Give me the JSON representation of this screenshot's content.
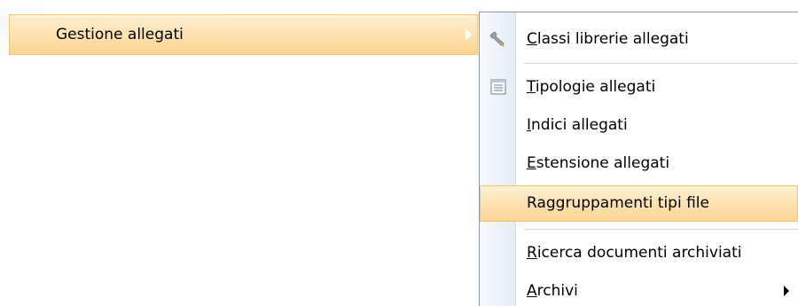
{
  "parent_menu": {
    "item_label": "Gestione allegati"
  },
  "submenu": {
    "items": [
      {
        "mnemonic": "C",
        "rest": "lassi librerie allegati",
        "icon": "wrench-icon"
      },
      {
        "mnemonic": "T",
        "rest": "ipologie allegati",
        "icon": "list-icon"
      },
      {
        "mnemonic": "I",
        "rest": "ndici allegati",
        "icon": ""
      },
      {
        "mnemonic": "E",
        "rest": "stensione allegati",
        "icon": ""
      },
      {
        "pre": "Ra",
        "mnemonic": "g",
        "rest": "gruppamenti tipi file",
        "icon": ""
      },
      {
        "mnemonic": "R",
        "rest": "icerca documenti archiviati",
        "icon": ""
      },
      {
        "mnemonic": "A",
        "rest": "rchivi",
        "icon": "submenu-arrow-icon"
      }
    ]
  }
}
